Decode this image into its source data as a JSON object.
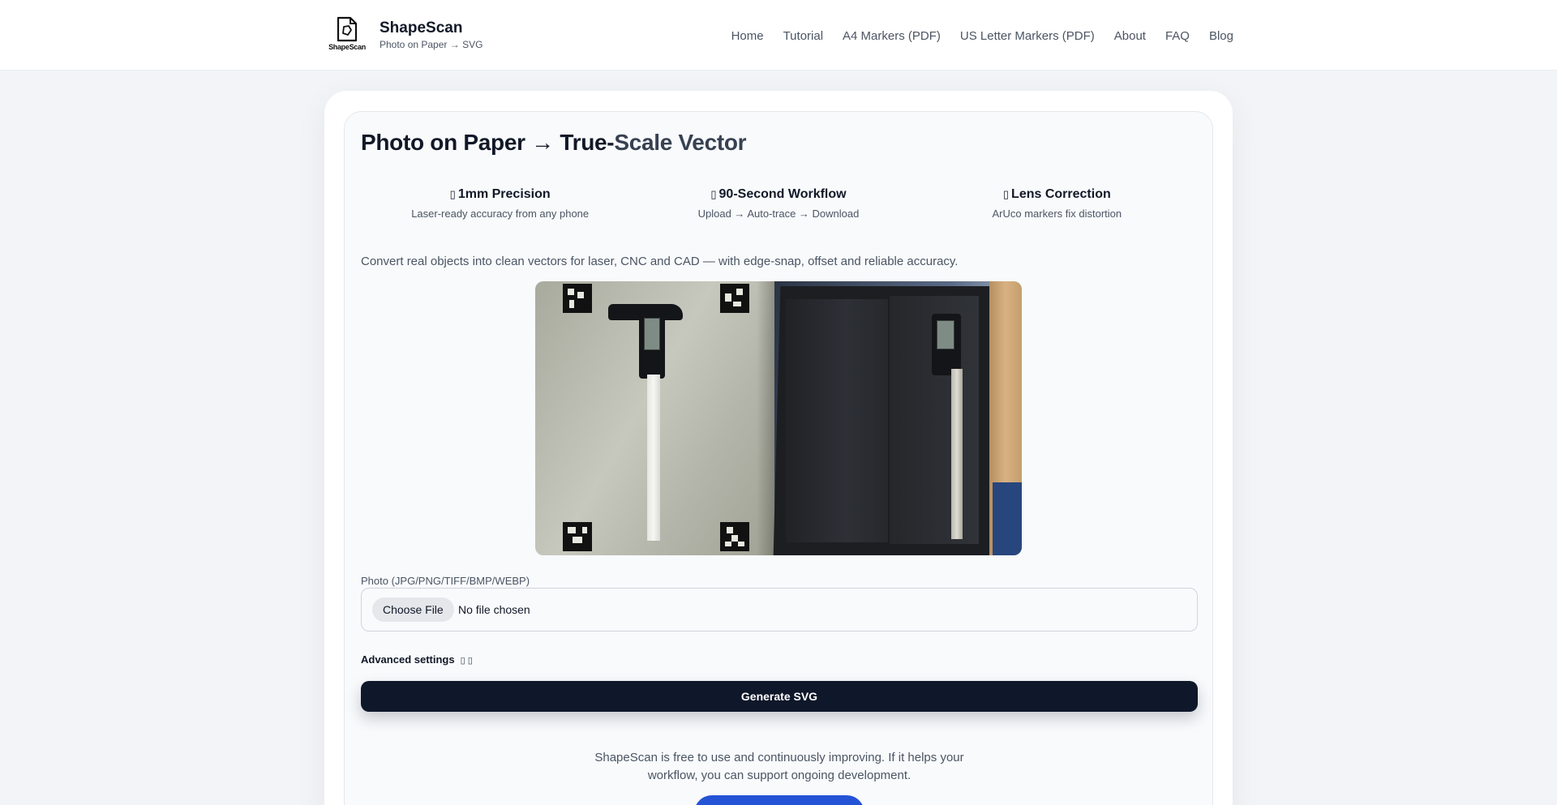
{
  "header": {
    "logo_text": "ShapeScan",
    "brand_name": "ShapeScan",
    "tagline": "Photo on Paper → SVG",
    "nav": [
      "Home",
      "Tutorial",
      "A4 Markers (PDF)",
      "US Letter Markers (PDF)",
      "About",
      "FAQ",
      "Blog"
    ]
  },
  "hero": {
    "title_main": "Photo on Paper → True-",
    "title_accent": "Scale Vector",
    "features": [
      {
        "icon": "target-icon",
        "glyph": "▯",
        "title": "1mm Precision",
        "desc": "Laser-ready accuracy from any phone"
      },
      {
        "icon": "timer-icon",
        "glyph": "▯",
        "title": "90-Second Workflow",
        "desc": "Upload → Auto-trace → Download"
      },
      {
        "icon": "lens-icon",
        "glyph": "▯",
        "title": "Lens Correction",
        "desc": "ArUco markers fix distortion"
      }
    ],
    "intro": "Convert real objects into clean vectors for laser, CNC and CAD — with edge-snap, offset and reliable accuracy."
  },
  "upload": {
    "label": "Photo (JPG/PNG/TIFF/BMP/WEBP)",
    "button": "Choose File",
    "status": "No file chosen"
  },
  "advanced": {
    "label": "Advanced settings",
    "icons": "▯ ▯"
  },
  "generate": {
    "label": "Generate SVG"
  },
  "support": {
    "text": "ShapeScan is free to use and continuously improving. If it helps your workflow, you can support ongoing development."
  },
  "colors": {
    "primary_button": "#0f172a",
    "support_button": "#2453d6",
    "page_bg": "#f2f4f7"
  }
}
